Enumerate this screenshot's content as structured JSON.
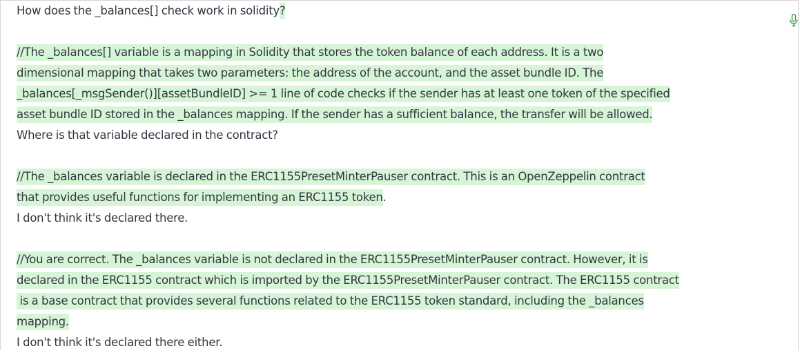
{
  "lines": [
    {
      "plain": "How does the _balances[] check work in solidity",
      "hl": "?"
    },
    {
      "plain": "",
      "hl": ""
    },
    {
      "plain": "",
      "hl": "//The _balances[] variable is a mapping in Solidity that stores the token balance of each address. It is a two"
    },
    {
      "plain": "",
      "hl": "dimensional mapping that takes two parameters: the address of the account, and the asset bundle ID. The"
    },
    {
      "plain": "",
      "hl": "_balances[_msgSender()][assetBundleID] >= 1 line of code checks if the sender has at least one token of the specified"
    },
    {
      "plain": "",
      "hl": "asset bundle ID stored in the _balances mapping. If the sender has a sufficient balance, the transfer will be allowed."
    },
    {
      "plain": "Where is that variable declared in the contract?",
      "hl": ""
    },
    {
      "plain": "",
      "hl": ""
    },
    {
      "plain": "",
      "hl": "//The _balances variable is declared in the ERC1155PresetMinterPauser contract. This is an OpenZeppelin contract"
    },
    {
      "plain": "",
      "hl": "that provides useful functions for implementing an ERC1155 token",
      "tail": "."
    },
    {
      "plain": "I don't think it's declared there.",
      "hl": ""
    },
    {
      "plain": "",
      "hl": ""
    },
    {
      "plain": "",
      "hl": "//You are correct. The _balances variable is not declared in the ERC1155PresetMinterPauser contract. However, it is"
    },
    {
      "plain": "",
      "hl": "declared in the ERC1155 contract which is imported by the ERC1155PresetMinterPauser contract. The ERC1155 contract"
    },
    {
      "plain": "",
      "hl": " is a base contract that provides several functions related to the ERC1155 token standard, including the _balances"
    },
    {
      "plain": "",
      "hl": "mapping."
    },
    {
      "plain": "I don't think it's declared there either.",
      "hl": ""
    }
  ],
  "icons": {
    "mic": "microphone-icon"
  },
  "colors": {
    "highlight": "#d6f5d6",
    "text": "#343541",
    "mic": "#2f9e44"
  }
}
